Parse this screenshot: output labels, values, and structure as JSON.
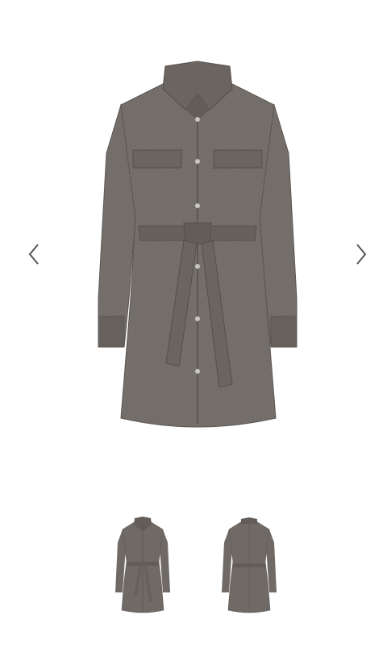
{
  "gallery": {
    "product_image": "grey-shirt-dress-front-belted",
    "prev_icon": "chevron-left-icon",
    "next_icon": "chevron-right-icon",
    "thumbnails": [
      {
        "image": "grey-shirt-dress-front-belted"
      },
      {
        "image": "grey-shirt-dress-back-belted"
      }
    ]
  },
  "colors": {
    "background": "#ffffff",
    "fabric": "#6f6a66",
    "fabric_dark": "#5b5653",
    "arrow": "#555555"
  }
}
